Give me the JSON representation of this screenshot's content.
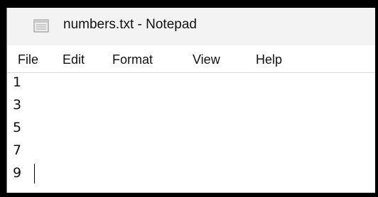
{
  "window": {
    "title": "numbers.txt - Notepad",
    "icon": "notepad-icon"
  },
  "menu": {
    "items": [
      "File",
      "Edit",
      "Format",
      "View",
      "Help"
    ]
  },
  "editor": {
    "lines": [
      "1",
      "3",
      "5",
      "7",
      "9"
    ]
  },
  "colors": {
    "frame": "#000000",
    "titlebar": "#f3f3f3",
    "text": "#111111"
  }
}
